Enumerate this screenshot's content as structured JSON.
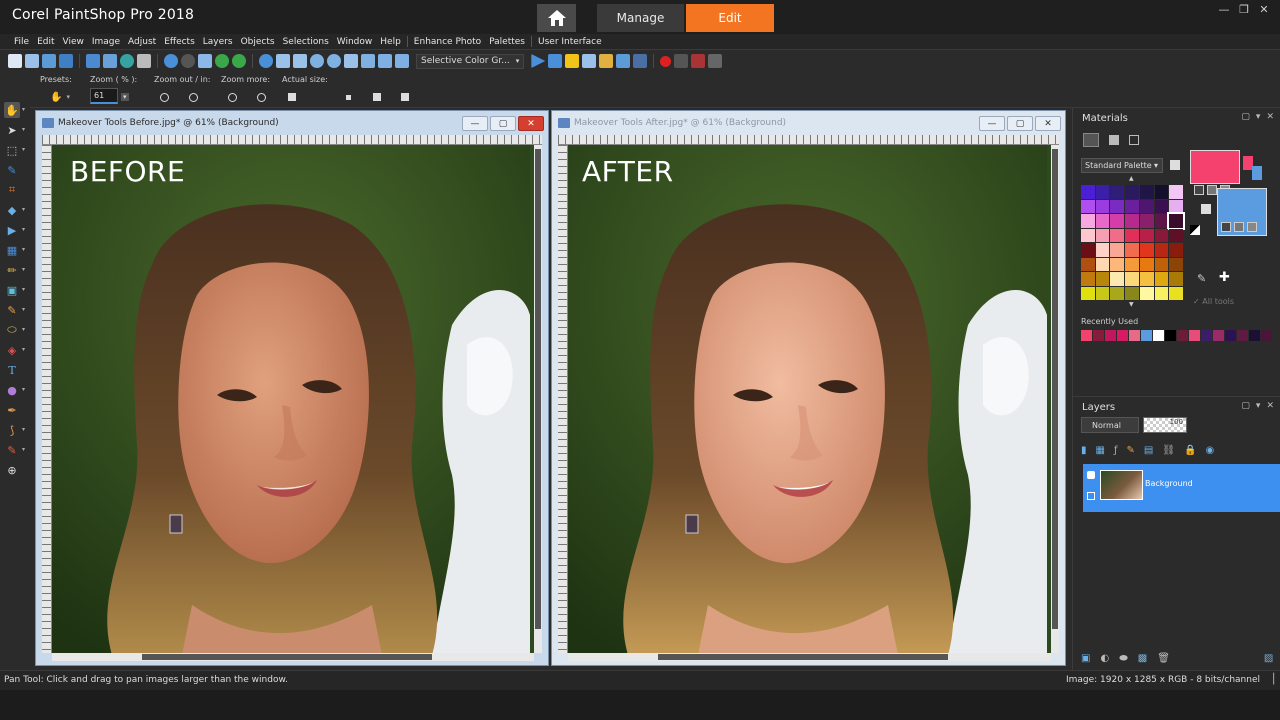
{
  "app": {
    "title": "Corel PaintShop Pro 2018",
    "brand_color": "#f47521"
  },
  "workspace_tabs": [
    {
      "label": "Manage",
      "active": false
    },
    {
      "label": "Edit",
      "active": true
    }
  ],
  "menu": [
    "File",
    "Edit",
    "View",
    "Image",
    "Adjust",
    "Effects",
    "Layers",
    "Objects",
    "Selections",
    "Window",
    "Help",
    "Enhance Photo",
    "Palettes",
    "User Interface"
  ],
  "toolbar": {
    "selective_color": "Selective Color Gr..."
  },
  "tool_options": {
    "presets_label": "Presets:",
    "zoom_label": "Zoom ( % ):",
    "zoom_value": "61",
    "zoom_out_in_label": "Zoom out / in:",
    "zoom_more_label": "Zoom more:",
    "actual_size_label": "Actual size:"
  },
  "documents": [
    {
      "title": "Makeover Tools Before.jpg* @  61% (Background)",
      "overlay": "BEFORE",
      "active": true
    },
    {
      "title": "Makeover Tools After.jpg* @  61% (Background)",
      "overlay": "AFTER",
      "active": false
    }
  ],
  "materials": {
    "title": "Materials",
    "palette": "Standard Palette",
    "all_tools": "All tools",
    "recently_used_label": "Recently Used",
    "foreground": "#f5416e",
    "background": "#5b9be0",
    "recent_colors": [
      "#f5416e",
      "#8a1a3a",
      "#c2185b",
      "#d81b60",
      "#e66a8a",
      "#5b9be0",
      "#ffffff",
      "#000000",
      "#6d1b3a",
      "#e84d7a",
      "#3b1d6a",
      "#9a2a6a",
      "#2c1250",
      "#5e1a40",
      "#1b1033",
      "#4a1638"
    ]
  },
  "layers": {
    "title": "Layers",
    "blend_mode": "Normal",
    "opacity": "100",
    "layer_name": "Background"
  },
  "status": {
    "hint": "Pan Tool: Click and drag to pan images larger than the window.",
    "image_info": "Image:  1920 x 1285 x RGB - 8 bits/channel"
  }
}
